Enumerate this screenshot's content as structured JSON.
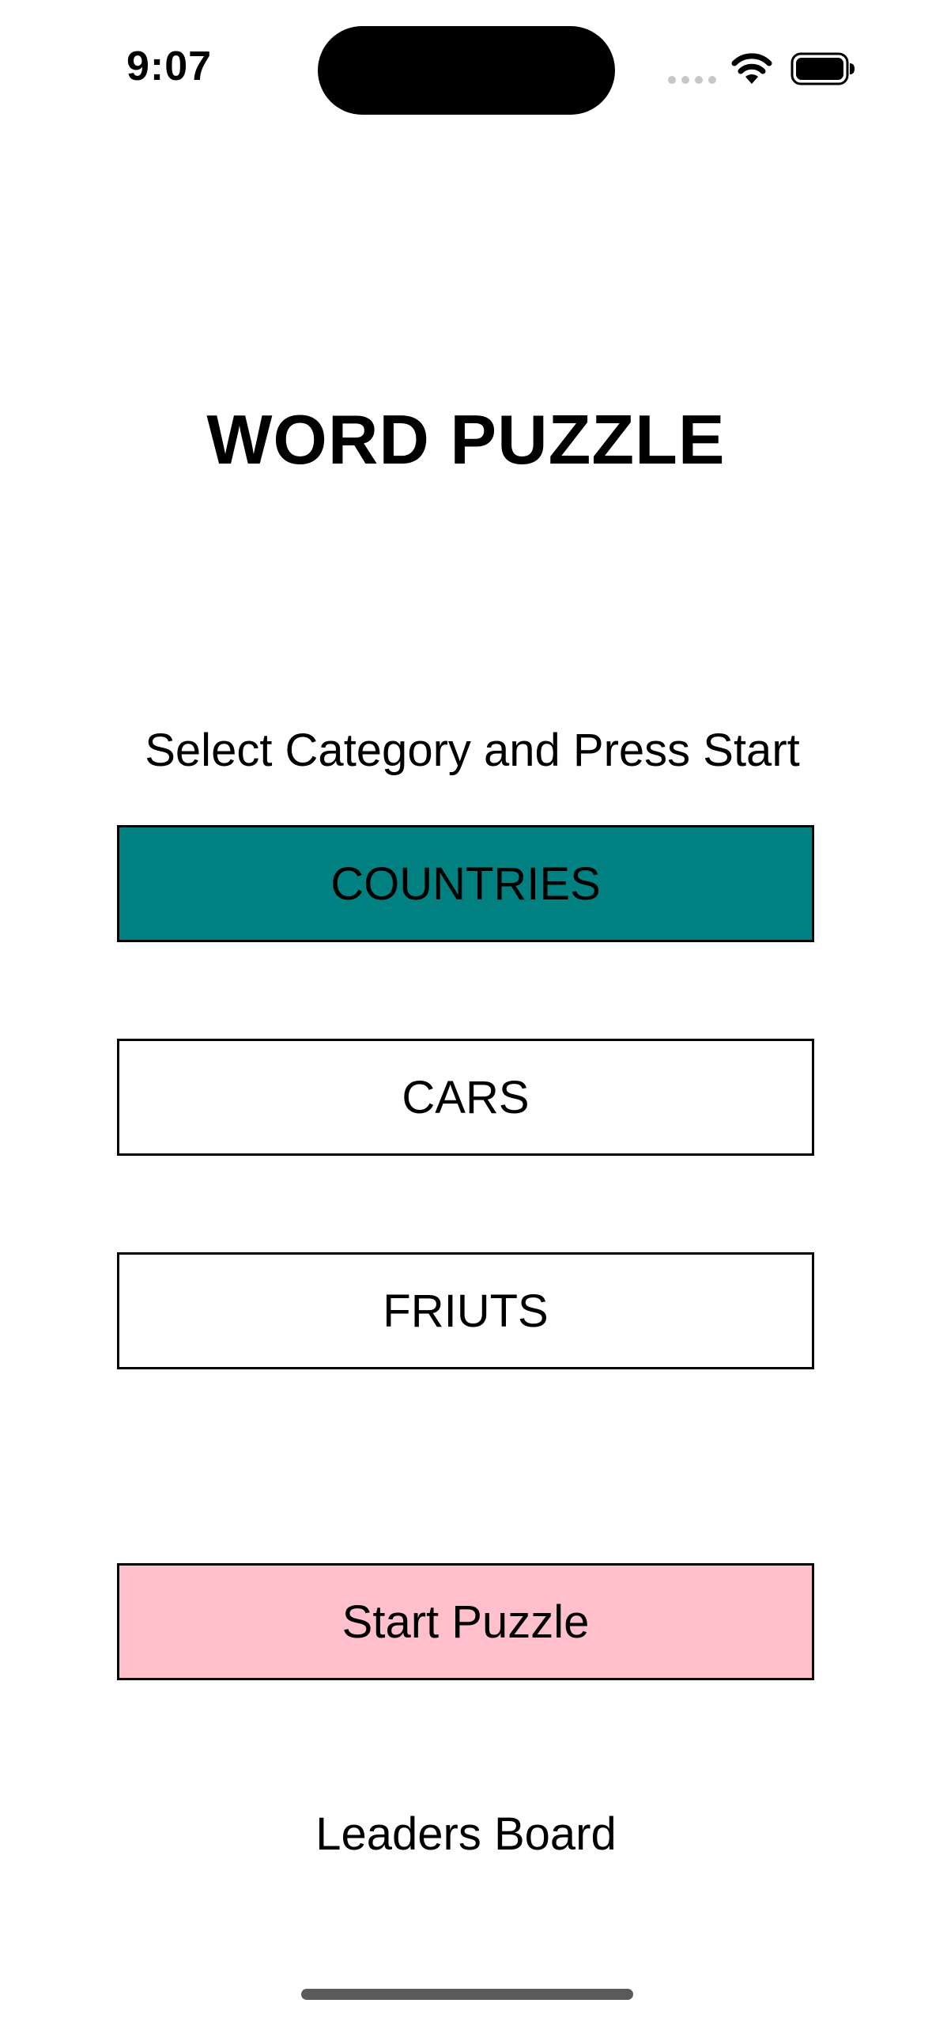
{
  "status_bar": {
    "time": "9:07",
    "icons": [
      "cellular-signal-icon",
      "wifi-icon",
      "battery-icon"
    ]
  },
  "title": "WORD PUZZLE",
  "subtitle": "Select Category and Press Start",
  "categories": [
    {
      "label": "COUNTRIES",
      "selected": true
    },
    {
      "label": "CARS",
      "selected": false
    },
    {
      "label": "FRIUTS",
      "selected": false
    }
  ],
  "start_button": {
    "label": "Start Puzzle"
  },
  "leaders_board": {
    "label": "Leaders Board"
  },
  "colors": {
    "selected_category": "#008080",
    "start_button": "#FFC0CB",
    "text": "#000000",
    "background": "#FFFFFF"
  }
}
